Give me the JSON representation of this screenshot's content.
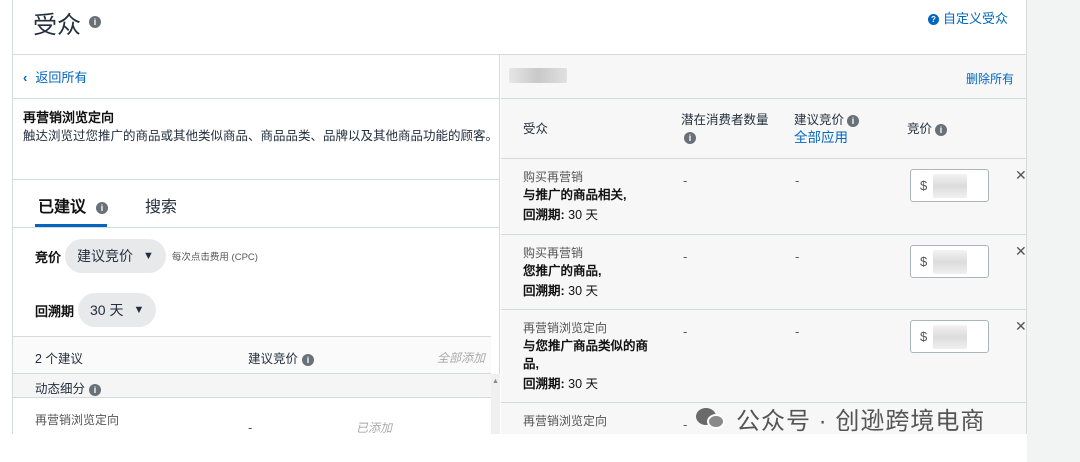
{
  "header": {
    "title": "受众",
    "help_link": "自定义受众"
  },
  "left": {
    "back_label": "返回所有",
    "description_title": "再营销浏览定向",
    "description_text": "触达浏览过您推广的商品或其他类似商品、商品品类、品牌以及其他商品功能的顾客。",
    "tabs": [
      {
        "label": "已建议",
        "active": true
      },
      {
        "label": "搜索",
        "active": false
      }
    ],
    "bid": {
      "label": "竞价",
      "selected": "建议竞价",
      "note": "每次点击费用 (CPC)"
    },
    "lookback": {
      "label": "回溯期",
      "selected": "30 天"
    },
    "suggestions_header": {
      "count": "2 个建议",
      "suggested_bid": "建议竞价",
      "add_all": "全部添加"
    },
    "dynamic_segment": "动态细分",
    "items": [
      {
        "name": "再营销浏览定向",
        "bid": "-",
        "status": "已添加"
      }
    ]
  },
  "right": {
    "remove_all": "删除所有",
    "columns": {
      "audience": "受众",
      "potential": "潜在消费者数量",
      "suggested_bid": "建议竞价",
      "apply_all": "全部应用",
      "bid": "竞价"
    },
    "rows": [
      {
        "type": "购买再营销",
        "desc": "与推广的商品相关,",
        "lookback_label": "回溯期:",
        "lookback_value": "30 天",
        "potential": "-",
        "suggested": "-",
        "currency": "$"
      },
      {
        "type": "购买再营销",
        "desc": "您推广的商品,",
        "lookback_label": "回溯期:",
        "lookback_value": "30 天",
        "potential": "-",
        "suggested": "-",
        "currency": "$"
      },
      {
        "type": "再营销浏览定向",
        "desc": "与您推广商品类似的商品,",
        "lookback_label": "回溯期:",
        "lookback_value": "30 天",
        "potential": "-",
        "suggested": "-",
        "currency": "$"
      },
      {
        "type": "再营销浏览定向",
        "potential": "-"
      }
    ]
  },
  "watermark": "公众号 · 创逊跨境电商",
  "colors": {
    "link": "#0066c0",
    "border": "#d5dbdb",
    "pill_bg": "#e8e9eb"
  }
}
